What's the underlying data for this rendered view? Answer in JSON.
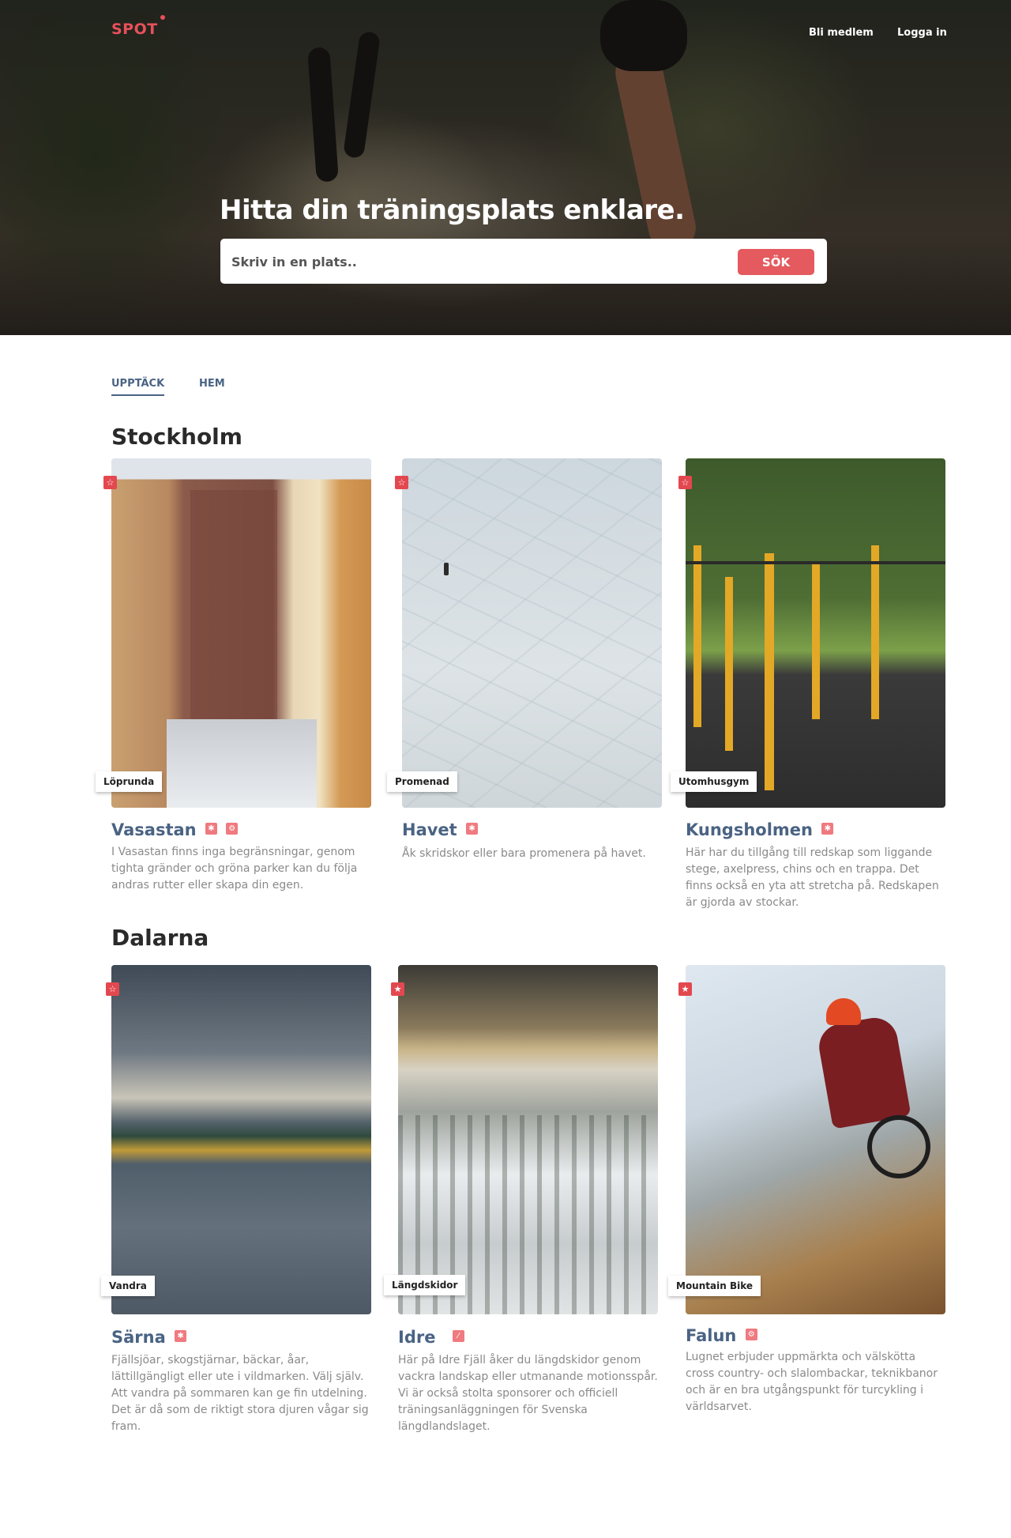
{
  "brand": {
    "logo": "SPOT",
    "accent": "#e8505b",
    "link_color": "#4a6383"
  },
  "nav": {
    "signup": "Bli medlem",
    "login": "Logga in"
  },
  "hero": {
    "title": "Hitta din träningsplats enklare.",
    "search_placeholder": "Skriv in en plats..",
    "search_button": "SÖK"
  },
  "tabs": [
    {
      "label": "UPPTÄCK",
      "active": true
    },
    {
      "label": "HEM",
      "active": false
    }
  ],
  "regions": [
    {
      "name": "Stockholm",
      "cards": [
        {
          "category": "Löprunda",
          "place": "Vasastan",
          "sports": [
            "running-icon",
            "cycling-icon"
          ],
          "description": "I Vasastan finns inga begränsningar, genom tighta gränder och gröna parker kan du följa andras rutter eller skapa din egen."
        },
        {
          "category": "Promenad",
          "place": "Havet",
          "sports": [
            "walking-icon"
          ],
          "description": "Åk skridskor eller bara promenera på havet."
        },
        {
          "category": "Utomhusgym",
          "place": "Kungsholmen",
          "sports": [
            "walking-icon"
          ],
          "description": "Här har du tillgång till redskap som liggande stege, axelpress, chins och en trappa. Det finns också en yta att stretcha på. Redskapen är gjorda av stockar."
        }
      ]
    },
    {
      "name": "Dalarna",
      "cards": [
        {
          "category": "Vandra",
          "place": "Särna",
          "sports": [
            "walking-icon"
          ],
          "description": "Fjällsjöar, skogstjärnar, bäckar, åar, lättillgängligt eller ute i vildmarken. Välj själv. Att vandra på sommaren kan ge fin utdelning. Det är då som de riktigt stora djuren vågar sig fram."
        },
        {
          "category": "Längdskidor",
          "place": "Idre",
          "sports": [
            "skiing-icon"
          ],
          "description": "Här på Idre Fjäll åker du längdskidor genom vackra landskap eller utmanande motionsspår. Vi är också stolta sponsorer och officiell träningsanläggningen för Svenska längdlandslaget."
        },
        {
          "category": "Mountain Bike",
          "place": "Falun",
          "sports": [
            "cycling-icon"
          ],
          "description": "Lugnet erbjuder uppmärkta och välskötta cross country- och slalombackar, teknikbanor och är en bra utgångspunkt för turcykling i världsarvet."
        }
      ]
    }
  ]
}
